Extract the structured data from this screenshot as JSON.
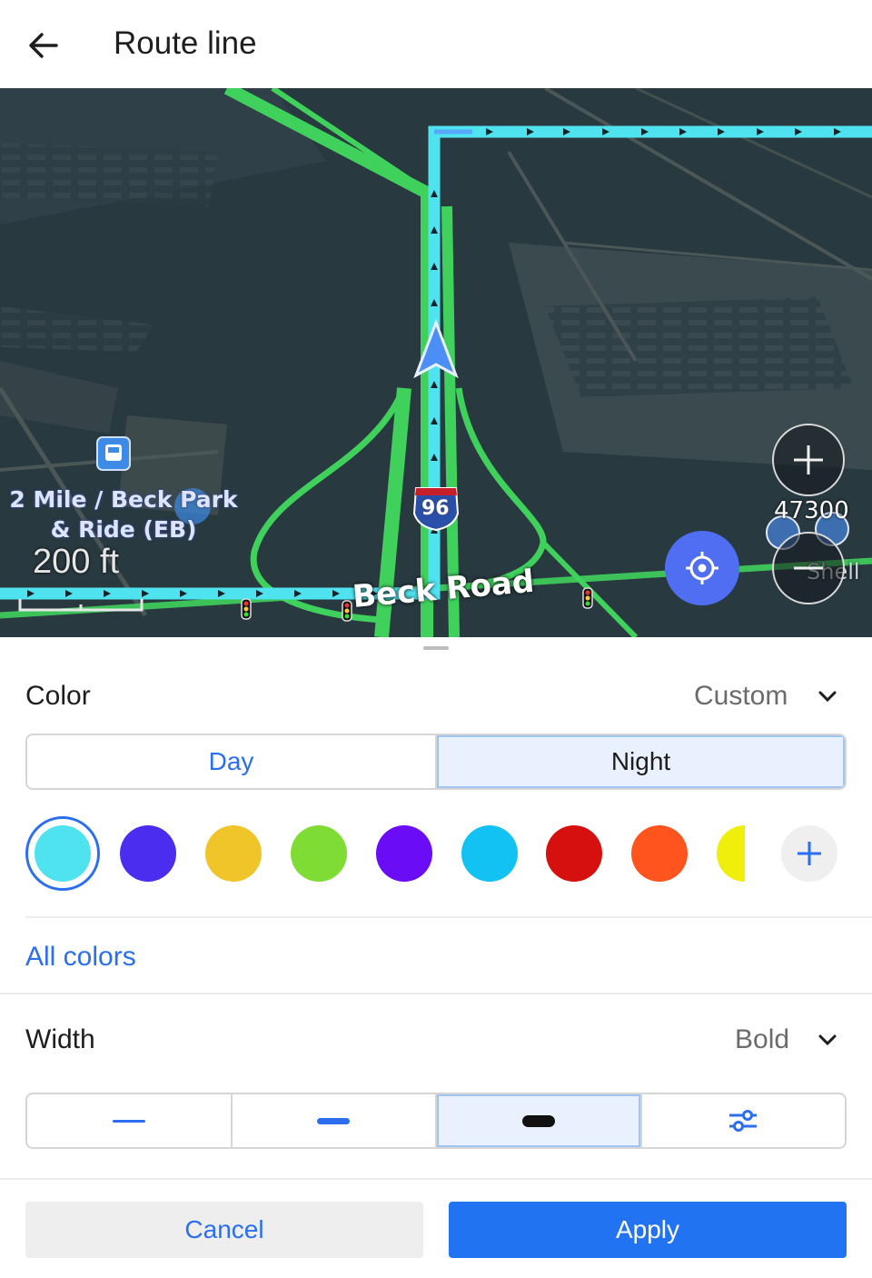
{
  "header": {
    "title": "Route line",
    "back_icon": "arrow-left-icon"
  },
  "map": {
    "poi_name": "2 Mile / Beck Park & Ride (EB)",
    "scale_label": "200 ft",
    "road_label": "Beck Road",
    "highway_shield": "96",
    "address_number": "47300",
    "shell_label": "Shell",
    "route_color": "#4fe3f0",
    "road_color": "#3fd15c"
  },
  "color_section": {
    "label": "Color",
    "value": "Custom",
    "tabs": [
      {
        "label": "Day",
        "selected": false
      },
      {
        "label": "Night",
        "selected": true
      }
    ],
    "swatches": [
      {
        "color": "#4fe3f0",
        "selected": true
      },
      {
        "color": "#4b2df0"
      },
      {
        "color": "#f0c52a"
      },
      {
        "color": "#7fdc34"
      },
      {
        "color": "#6a0cf5"
      },
      {
        "color": "#12c2f2"
      },
      {
        "color": "#d6100f"
      },
      {
        "color": "#ff541d"
      },
      {
        "color": "#f0ef0b"
      }
    ],
    "add_icon": "plus-icon",
    "all_colors_link": "All colors"
  },
  "width_section": {
    "label": "Width",
    "value": "Bold",
    "options": [
      {
        "name": "thin",
        "selected": false
      },
      {
        "name": "medium",
        "selected": false
      },
      {
        "name": "bold",
        "selected": true
      },
      {
        "name": "custom",
        "icon": "sliders-icon",
        "selected": false
      }
    ]
  },
  "footer": {
    "cancel_label": "Cancel",
    "apply_label": "Apply"
  },
  "colors": {
    "accent": "#2b6ff0",
    "apply_bg": "#2273f2",
    "cancel_bg": "#eeeeee",
    "selected_bg": "#e8f1fd"
  }
}
